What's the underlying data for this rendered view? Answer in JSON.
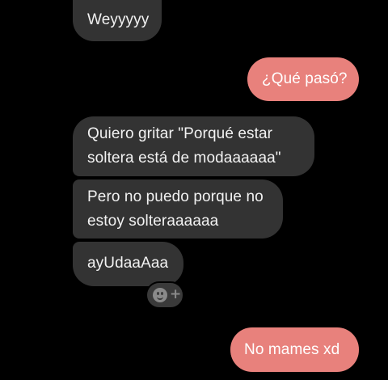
{
  "messages": [
    {
      "direction": "incoming",
      "lines": [
        "Weyyyyy"
      ]
    },
    {
      "direction": "outgoing",
      "lines": [
        "¿Qué pasó?"
      ]
    },
    {
      "direction": "incoming",
      "lines": [
        "Quiero gritar \"Porqué estar",
        "soltera está de modaaaaaa\""
      ]
    },
    {
      "direction": "incoming",
      "lines": [
        "Pero no puedo porque no",
        "estoy solteraaaaaa"
      ]
    },
    {
      "direction": "incoming",
      "lines": [
        "ayUdaaAaa"
      ]
    },
    {
      "direction": "outgoing",
      "lines": [
        "No mames xd"
      ]
    }
  ],
  "reaction_button": {
    "icon": "smiley-add-icon",
    "symbol": "+"
  },
  "colors": {
    "background": "#000000",
    "incoming_bubble": "#333333",
    "outgoing_bubble": "#e8817c",
    "text": "#ffffff"
  }
}
